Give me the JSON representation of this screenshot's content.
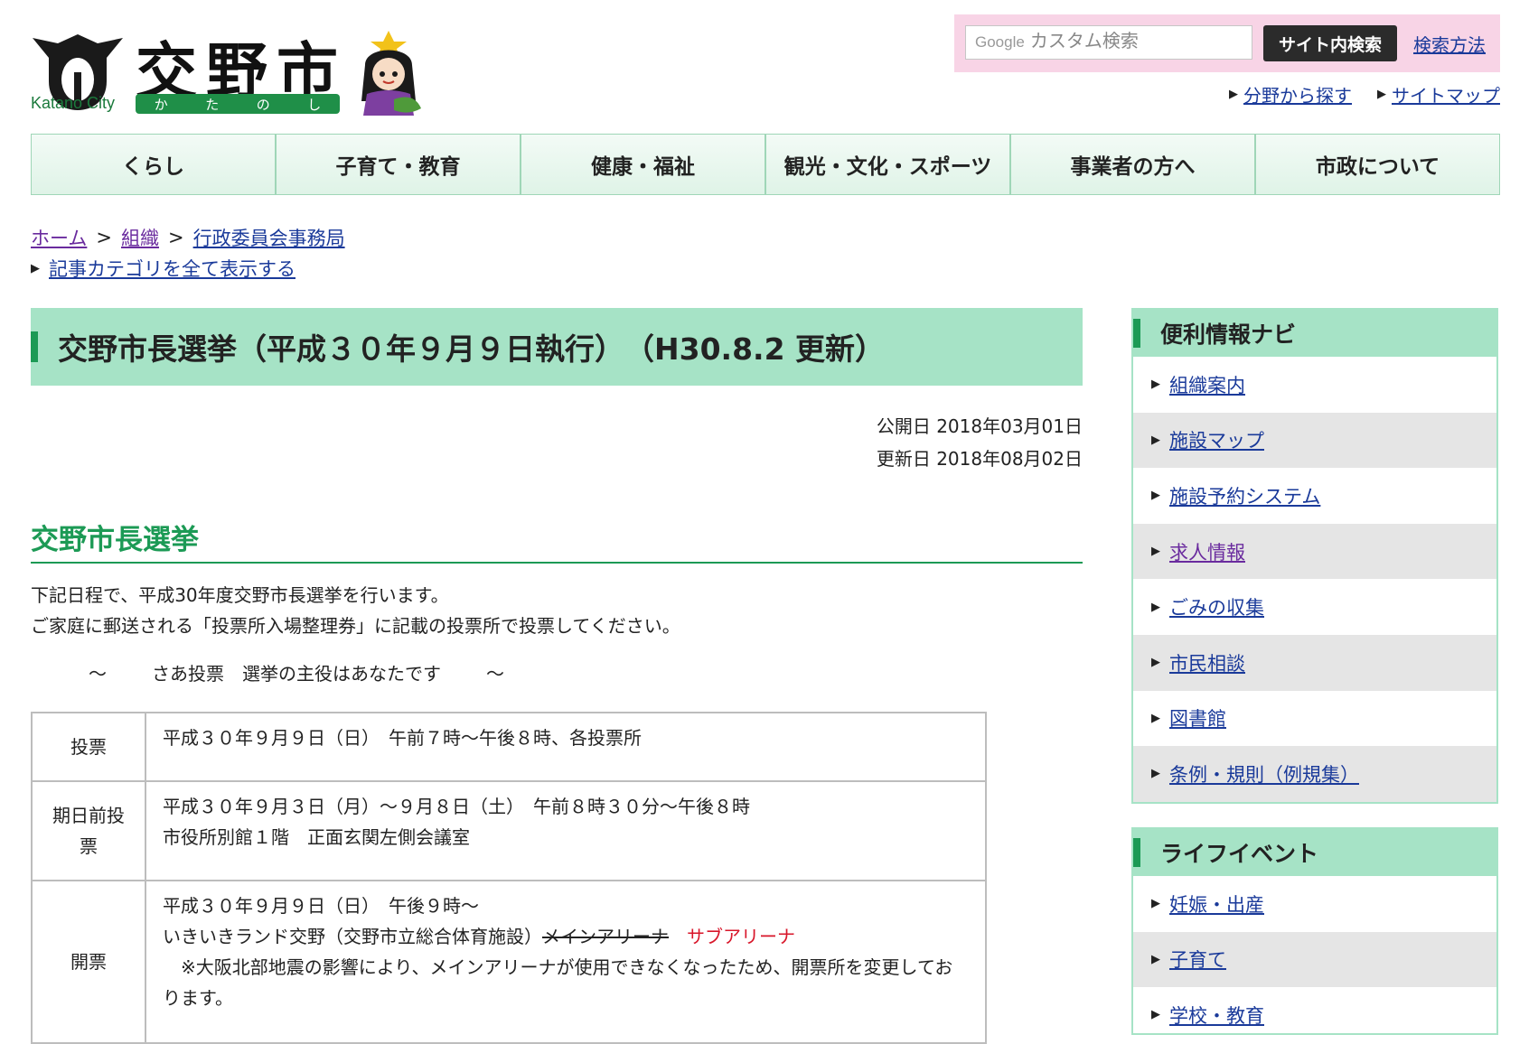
{
  "header": {
    "logo_title": "交野市",
    "logo_en": "Katano City",
    "logo_kana": [
      "か",
      "た",
      "の",
      "し"
    ],
    "search": {
      "brand": "Google",
      "placeholder": "カスタム検索",
      "button": "サイト内検索",
      "help": "検索方法"
    },
    "links": [
      "分野から探す",
      "サイトマップ"
    ]
  },
  "nav": [
    "くらし",
    "子育て・教育",
    "健康・福祉",
    "観光・文化・スポーツ",
    "事業者の方へ",
    "市政について"
  ],
  "breadcrumb": {
    "items": [
      "ホーム",
      "組織",
      "行政委員会事務局"
    ],
    "sep": ">",
    "category_link": "記事カテゴリを全て表示する"
  },
  "article": {
    "title": "交野市長選挙（平成３０年９月９日執行）　（H30.8.2 更新）",
    "published": "公開日 2018年03月01日",
    "updated": "更新日 2018年08月02日",
    "section_title": "交野市長選挙",
    "intro": [
      "下記日程で、平成30年度交野市長選挙を行います。",
      "ご家庭に郵送される「投票所入場整理券」に記載の投票所で投票してください。"
    ],
    "slogan": [
      "～",
      "さあ投票　選挙の主役はあなたです",
      "～"
    ],
    "table": {
      "row1": {
        "head": "投票",
        "line1": "平成３０年９月９日（日）　午前７時～午後８時、各投票所"
      },
      "row2": {
        "head": "期日前投票",
        "line1": "平成３０年９月３日（月）～９月８日（土）　午前８時３０分～午後８時",
        "line2": "市役所別館１階　正面玄関左側会議室"
      },
      "row3": {
        "head": "開票",
        "line1": "平成３０年９月９日（日）　午後９時～",
        "line2_prefix": "いきいきランド交野（交野市立総合体育施設）",
        "line2_strike": "メインアリーナ",
        "line2_new": "サブアリーナ",
        "line3": "　※大阪北部地震の影響により、メインアリーナが使用できなくなったため、開票所を変更しております。"
      }
    }
  },
  "sidebar": {
    "navi_title": "便利情報ナビ",
    "navi_items": [
      "組織案内",
      "施設マップ",
      "施設予約システム",
      "求人情報",
      "ごみの収集",
      "市民相談",
      "図書館",
      "条例・規則（例規集）"
    ],
    "life_title": "ライフイベント",
    "life_items": [
      "妊娠・出産",
      "子育て",
      "学校・教育"
    ]
  },
  "colors": {
    "brand_green": "#1c9a55",
    "nav_border": "#9fd6b7",
    "heading_bg": "#a6e3c6",
    "search_bg": "#f8d4e6",
    "link": "#1a3a9a",
    "visited_link": "#6a2b9e",
    "alert_red": "#d8162a"
  }
}
